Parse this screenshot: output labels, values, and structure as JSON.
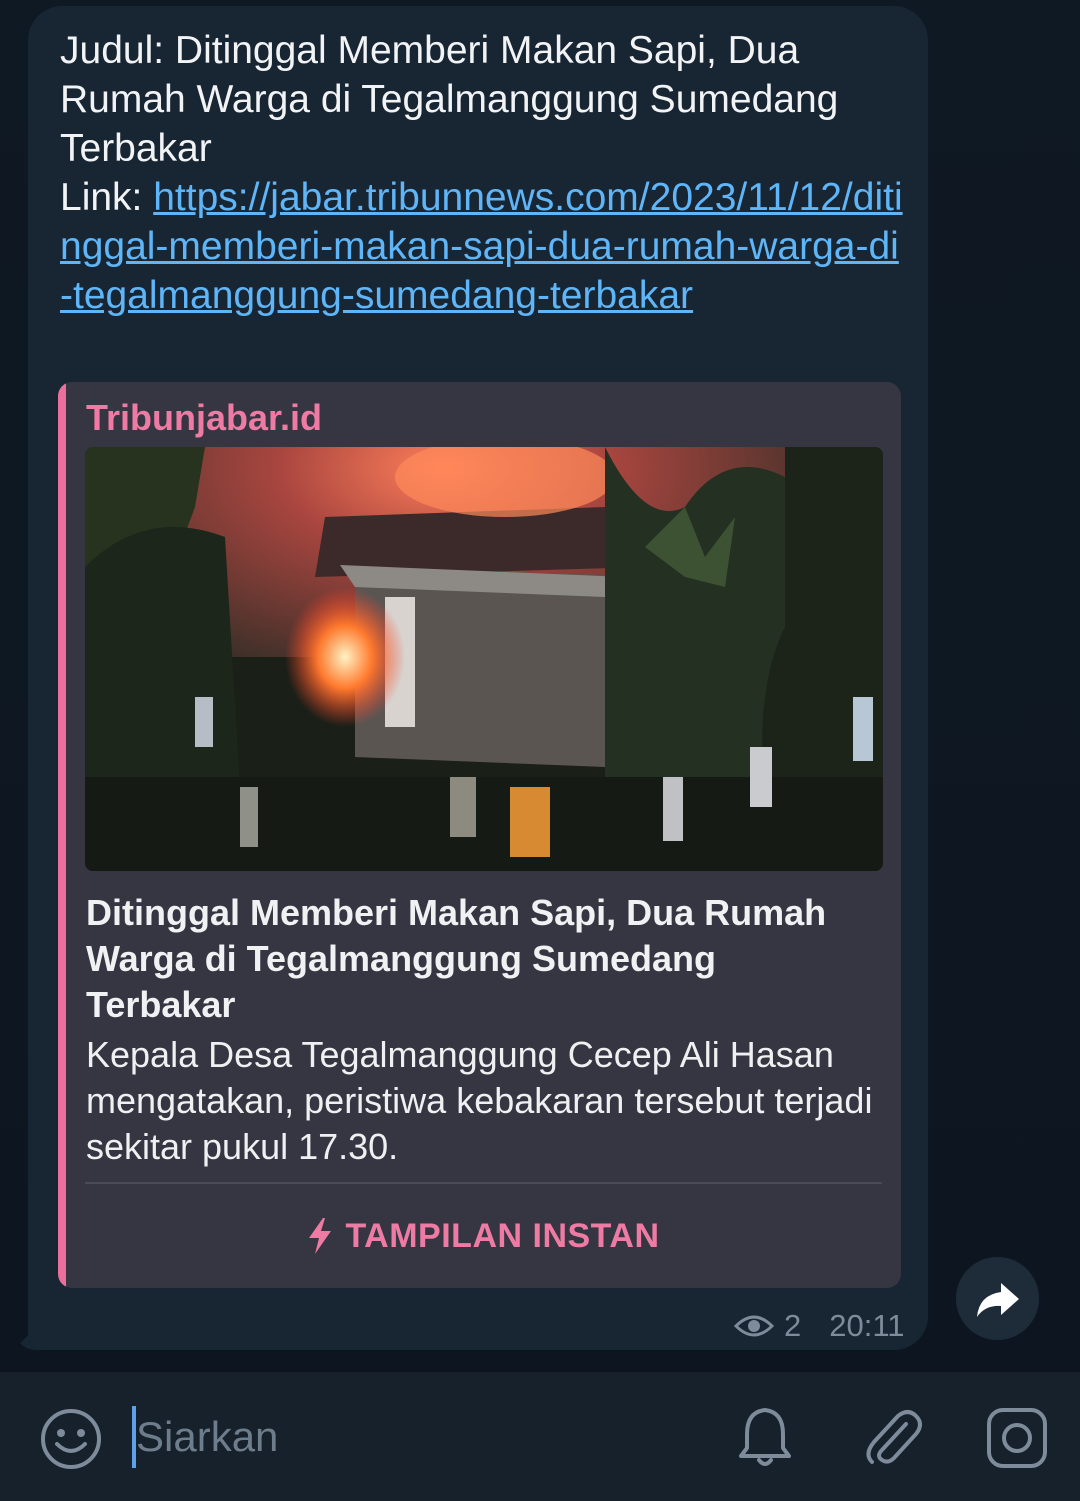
{
  "message": {
    "text_prefix": "Judul: Ditinggal Memberi Makan Sapi, Dua Rumah Warga di Tegalmanggung Sumedang Terbakar",
    "link_label": "Link: ",
    "link_url": "https://jabar.tribunnews.com/2023/11/12/ditinggal-memberi-makan-sapi-dua-rumah-warga-di-tegalmanggung-sumedang-terbakar",
    "views": "2",
    "time": "20:11"
  },
  "preview": {
    "site_name": "Tribunjabar.id",
    "title": "Ditinggal Memberi Makan Sapi, Dua Rumah Warga di Tegalmanggung Sumedang Terbakar",
    "description": "Kepala Desa Tegalmanggung Cecep Ali Hasan mengatakan, peristiwa kebakaran tersebut terjadi sekitar pukul 17.30.",
    "instant_view_label": "TAMPILAN INSTAN"
  },
  "input": {
    "placeholder": "Siarkan"
  },
  "icons": {
    "views": "eye-icon",
    "share": "share-icon",
    "emoji": "emoji-icon",
    "bell": "bell-icon",
    "attach": "paperclip-icon",
    "camera": "camera-icon",
    "instant": "lightning-icon"
  },
  "colors": {
    "link": "#5eb5f7",
    "accent_pink": "#ee7ba3",
    "bubble": "#182533",
    "preview_bg": "#363642"
  }
}
